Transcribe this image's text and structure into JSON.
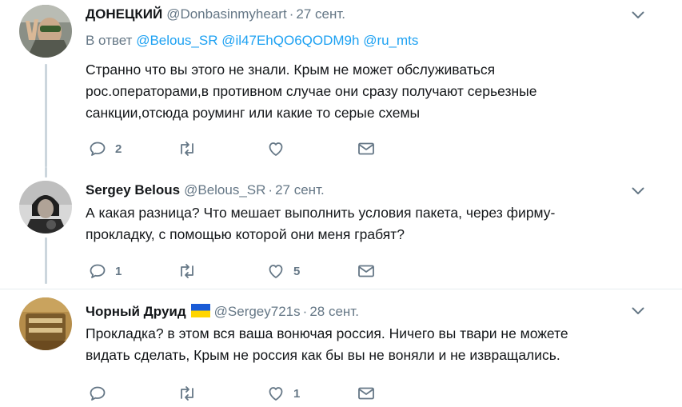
{
  "tweets": [
    {
      "name": "ДОНЕЦКИЙ",
      "handle": "@Donbasinmyheart",
      "separator": "·",
      "time": "27 сент.",
      "reply_prefix": "В ответ",
      "mentions": [
        "@Belous_SR",
        "@il47EhQO6QODM9h",
        "@ru_mts"
      ],
      "lines": [
        "Странно что вы этого не знали. Крым не может обслуживаться",
        "рос.операторами,в противном случае они сразу  получают серьезные",
        "санкции,отсюда роуминг или какие то серые схемы"
      ],
      "reply_count": "2",
      "retweet_count": "",
      "like_count": ""
    },
    {
      "name": "Sergey Belous",
      "handle": "@Belous_SR",
      "separator": "·",
      "time": "27 сент.",
      "lines": [
        "А какая разница? Что мешает выполнить условия пакета, через фирму-",
        "прокладку, с помощью которой они меня грабят?"
      ],
      "reply_count": "1",
      "retweet_count": "",
      "like_count": "5"
    },
    {
      "name": "Чорный Друид",
      "flag_icon": "ukraine-flag-icon",
      "handle": "@Sergey721s",
      "separator": "·",
      "time": "28 сент.",
      "lines": [
        "Прокладка? в этом вся ваша вонючая россия. Ничего вы твари не можете",
        "видать сделать, Крым не россия как бы вы не воняли и не извращались."
      ],
      "reply_count": "",
      "retweet_count": "",
      "like_count": "1"
    }
  ],
  "colors": {
    "link": "#1da1f2",
    "secondary_text": "#657786",
    "thread_line": "#ccd6dd",
    "flag_blue": "#1a5bd6",
    "flag_yellow": "#ffd500"
  }
}
